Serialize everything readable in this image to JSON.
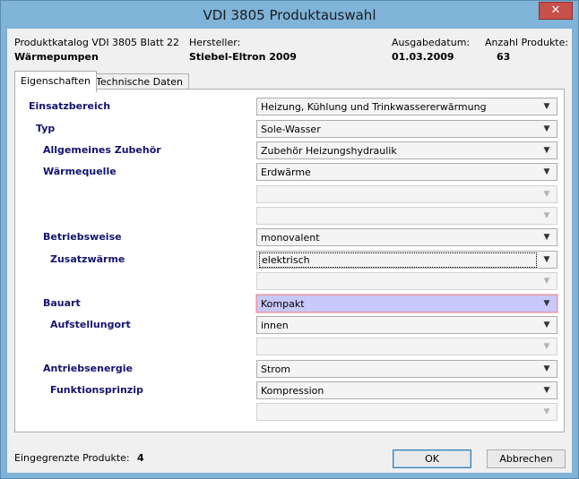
{
  "window": {
    "title": "VDI 3805 Produktauswahl",
    "close_label": "✕"
  },
  "header": {
    "catalog_label": "Produktkatalog VDI 3805 Blatt 22",
    "catalog_value": "Wärmepumpen",
    "manufacturer_label": "Hersteller:",
    "manufacturer_value": "Stiebel-Eltron 2009",
    "date_label": "Ausgabedatum:",
    "date_value": "01.03.2009",
    "count_label": "Anzahl Produkte:",
    "count_value": "63"
  },
  "tabs": [
    {
      "label": "Eigenschaften",
      "active": true
    },
    {
      "label": "Technische Daten",
      "active": false
    }
  ],
  "properties": {
    "einsatzbereich": {
      "label": "Einsatzbereich",
      "value": "Heizung, Kühlung und Trinkwassererwärmung"
    },
    "typ": {
      "label": "Typ",
      "value": "Sole-Wasser"
    },
    "zubehoer": {
      "label": "Allgemeines Zubehör",
      "value": "Zubehör Heizungshydraulik"
    },
    "waermequelle": {
      "label": "Wärmequelle",
      "value": "Erdwärme"
    },
    "betriebsweise": {
      "label": "Betriebsweise",
      "value": "monovalent"
    },
    "zusatzwaerme": {
      "label": "Zusatzwärme",
      "value": "elektrisch"
    },
    "bauart": {
      "label": "Bauart",
      "value": "Kompakt"
    },
    "aufstellungort": {
      "label": "Aufstellungort",
      "value": "innen"
    },
    "antriebsenergie": {
      "label": "Antriebsenergie",
      "value": "Strom"
    },
    "funktionsprinzip": {
      "label": "Funktionsprinzip",
      "value": "Kompression"
    }
  },
  "footer": {
    "filtered_label": "Eingegrenzte Produkte:",
    "filtered_value": "4",
    "ok_label": "OK",
    "cancel_label": "Abbrechen"
  },
  "icons": {
    "dropdown_arrow": "chevron-down-icon"
  }
}
